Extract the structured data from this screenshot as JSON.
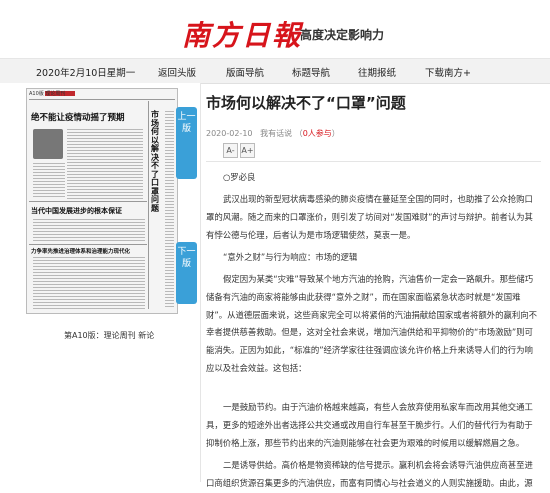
{
  "header": {
    "logo_text": "南方日報",
    "slogan": "高度决定影响力"
  },
  "nav": {
    "date": "2020年2月10日星期一",
    "items": [
      "返回头版",
      "版面导航",
      "标题导航",
      "往期报纸",
      "下载南方+"
    ]
  },
  "thumbnail": {
    "page_header": "A10版 理论周刊",
    "headline1": "绝不能让疫情动摇了预期",
    "headline2": "当代中国发展进步的根本保证",
    "headline3": "力争率先推进治理体系和治理能力现代化",
    "vertical_title": "市场何以解决不了口罩问题",
    "caption": "第A10版：理论周刊 新论",
    "prev_label": "上一版",
    "next_label": "下一版"
  },
  "article": {
    "title": "市场何以解决不了“口罩”问题",
    "date": "2020-02-10",
    "comment_label": "我有话说",
    "comment_count": "0人参与",
    "font_dec": "A-",
    "font_inc": "A+",
    "author": "○罗必良",
    "paragraphs": [
      "武汉出现的新型冠状病毒感染的肺炎疫情在蔓延至全国的同时，也助推了公众抢购口罩的风潮。随之而来的口罩涨价，则引发了坊间对“发国难财”的声讨与辩护。前者认为其有悖公德与伦理，后者认为是市场逻辑使然，莫衷一是。",
      "假定因为某类“灾难”导致某个地方汽油的抢购，汽油售价一定会一路飙升。那些储巧储备有汽油的商家将能够由此获得“意外之财”，而在国家面临紧急状态时就是“发国难财”。从道德层面来说，这些商家完全可以将紧俏的汽油捐献给国家或者将额外的赢利向不幸者提供慈善救助。但是，这对全社会来说，增加汽油供给和平抑物价的“市场激励”则可能消失。正因为如此，“标准的”经济学家往往强调应该允许价格上升来诱导人们的行为响应以及社会效益。这包括：",
      "一是鼓励节约。由于汽油价格越来越高，有些人会放弃使用私家车而改用其他交通工具，更多的短途外出者选择公共交通或改用自行车甚至干脆步行。人们的替代行为有助于抑制价格上涨，那些节约出来的汽油则能够在社会更为艰难的时候用以缓解燃眉之急。",
      "二是诱导供给。高价格是物资稀缺的信号提示。赢利机会将会诱导汽油供应商甚至进口商组织货源召集更多的汽油供应，而富有同情心与社会道义的人则实施援助。由此，源"
    ],
    "subheading": "“意外之财”与行为响应：市场的逻辑"
  }
}
